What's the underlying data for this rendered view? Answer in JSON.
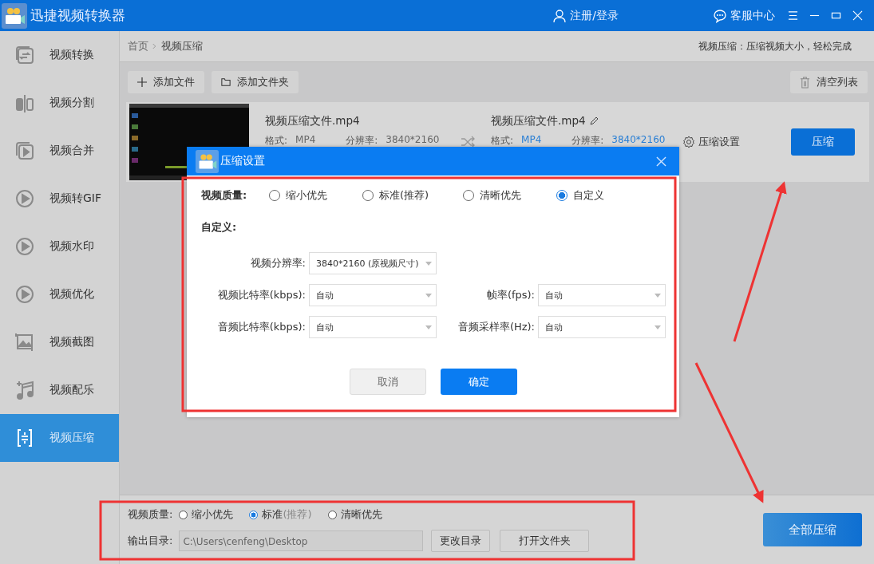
{
  "app": {
    "title": "迅捷视频转换器",
    "user": "注册/登录",
    "support": "客服中心"
  },
  "sidebar": {
    "items": [
      {
        "label": "视频转换",
        "selected": false
      },
      {
        "label": "视频分割",
        "selected": false
      },
      {
        "label": "视频合并",
        "selected": false
      },
      {
        "label": "视频转GIF",
        "selected": false
      },
      {
        "label": "视频水印",
        "selected": false
      },
      {
        "label": "视频优化",
        "selected": false
      },
      {
        "label": "视频截图",
        "selected": false
      },
      {
        "label": "视频配乐",
        "selected": false
      },
      {
        "label": "视频压缩",
        "selected": true
      }
    ]
  },
  "breadcrumb": {
    "items": [
      "首页",
      "视频压缩"
    ],
    "tagline": "视频压缩：压缩视频大小，轻松完成"
  },
  "toolbar": {
    "add_file": "添加文件",
    "add_folder": "添加文件夹",
    "clear_list": "清空列表"
  },
  "file": {
    "source_name": "视频压缩文件.mp4",
    "format_label": "格式:",
    "source_format": "MP4",
    "resolution_label": "分辨率:",
    "source_resolution": "3840*2160",
    "output_name": "视频压缩文件.mp4",
    "output_format_label": "格式:",
    "output_format": "MP4",
    "output_resolution_label": "分辨率:",
    "output_resolution": "3840*2160",
    "settings": "压缩设置",
    "compress": "压缩"
  },
  "dialog": {
    "title": "压缩设置",
    "quality_label": "视频质量:",
    "quality_options": [
      {
        "label": "缩小优先",
        "selected": false
      },
      {
        "label": "标准(推荐)",
        "selected": false
      },
      {
        "label": "清晰优先",
        "selected": false
      },
      {
        "label": "自定义",
        "selected": true
      }
    ],
    "custom_heading": "自定义:",
    "rows": [
      [
        {
          "label": "视频分辨率:",
          "value": "3840*2160 (原视频尺寸)"
        }
      ],
      [
        {
          "label": "视频比特率(kbps):",
          "value": "自动"
        },
        {
          "label": "帧率(fps):",
          "value": "自动"
        }
      ],
      [
        {
          "label": "音频比特率(kbps):",
          "value": "自动"
        },
        {
          "label": "音频采样率(Hz):",
          "value": "自动"
        }
      ]
    ],
    "cancel": "取消",
    "ok": "确定"
  },
  "bottom": {
    "quality_label": "视频质量:",
    "options": [
      {
        "label": "缩小优先",
        "selected": false
      },
      {
        "label": "标准",
        "hint": "(推荐)",
        "selected": true
      },
      {
        "label": "清晰优先",
        "selected": false
      }
    ],
    "output_label": "输出目录:",
    "output_path": "C:\\Users\\cenfeng\\Desktop",
    "change_dir": "更改目录",
    "open_folder": "打开文件夹",
    "compress_all": "全部压缩"
  }
}
